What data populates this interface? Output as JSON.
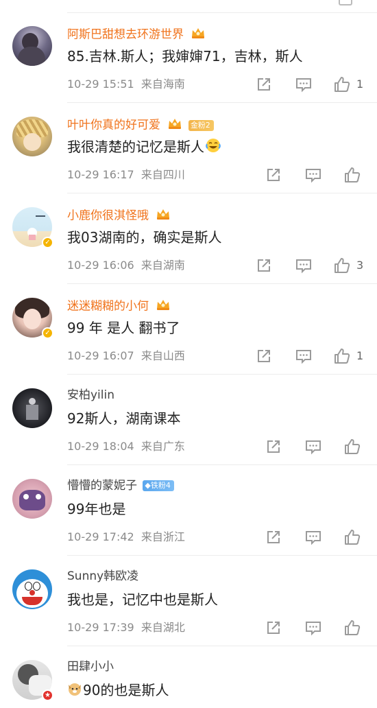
{
  "comments": [
    {
      "name": "阿斯巴甜想去环游世界",
      "text": "85.吉林.斯人；我婶婶71，吉林，斯人",
      "time": "10-29 15:51",
      "location": "来自海南",
      "likes": "1",
      "vip": true,
      "fan": "",
      "badge": ""
    },
    {
      "name": "叶叶你真的好可爱",
      "text": "我很清楚的记忆是斯人",
      "time": "10-29 16:17",
      "location": "来自四川",
      "likes": "",
      "vip": true,
      "fan": "金粉2",
      "badge": ""
    },
    {
      "name": "小鹿你很淇怪哦",
      "text": "我03湖南的，确实是斯人",
      "time": "10-29 16:06",
      "location": "来自湖南",
      "likes": "3",
      "vip": true,
      "fan": "",
      "badge": "v"
    },
    {
      "name": "迷迷糊糊的小何",
      "text": "99 年 是人 翻书了",
      "time": "10-29 16:07",
      "location": "来自山西",
      "likes": "1",
      "vip": true,
      "fan": "",
      "badge": "v"
    },
    {
      "name": "安柏yilin",
      "text": "92斯人，湖南课本",
      "time": "10-29 18:04",
      "location": "来自广东",
      "likes": "",
      "vip": false,
      "fan": "",
      "badge": ""
    },
    {
      "name": "懵懵的蒙妮子",
      "text": "99年也是",
      "time": "10-29 17:42",
      "location": "来自浙江",
      "likes": "",
      "vip": false,
      "fan": "铁粉4",
      "badge": ""
    },
    {
      "name": "Sunny韩欧凌",
      "text": "我也是，记忆中也是斯人",
      "time": "10-29 17:39",
      "location": "来自湖北",
      "likes": "",
      "vip": false,
      "fan": "",
      "badge": ""
    },
    {
      "name": "田肆小小",
      "text": "90的也是斯人",
      "time": "",
      "location": "",
      "likes": "",
      "vip": false,
      "fan": "",
      "badge": "red"
    }
  ],
  "icons": {
    "share": "share-icon",
    "comment": "comment-icon",
    "like": "like-icon",
    "crown": "vip-crown-icon"
  },
  "colors": {
    "vip_name": "#f0731c",
    "meta": "#8a8a8a",
    "divider": "#ececec"
  }
}
